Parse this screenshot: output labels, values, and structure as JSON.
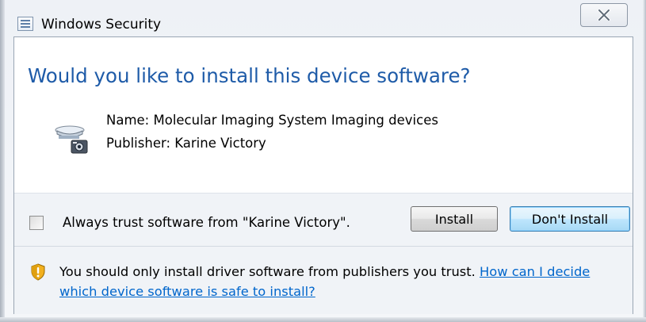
{
  "window": {
    "title": "Windows Security",
    "title_icon": "list-window-icon",
    "close_icon": "close-icon"
  },
  "dialog": {
    "heading": "Would you like to install this device software?",
    "device_icon": "scanner-camera-device-icon",
    "name_line": "Name: Molecular Imaging System Imaging devices",
    "publisher_line": "Publisher: Karine Victory"
  },
  "footer": {
    "trust_checkbox_checked": false,
    "trust_checkbox_label": "Always trust software from \"Karine Victory\".",
    "install_button": "Install",
    "dont_install_button": "Don't Install",
    "warning_icon": "security-shield-icon",
    "warning_text": "You should only install driver software from publishers you trust.",
    "help_link": "How can I decide which device software is safe to install?"
  },
  "colors": {
    "heading": "#1e5ba8",
    "link": "#0066cc",
    "footer_background": "#f0f3f7"
  }
}
